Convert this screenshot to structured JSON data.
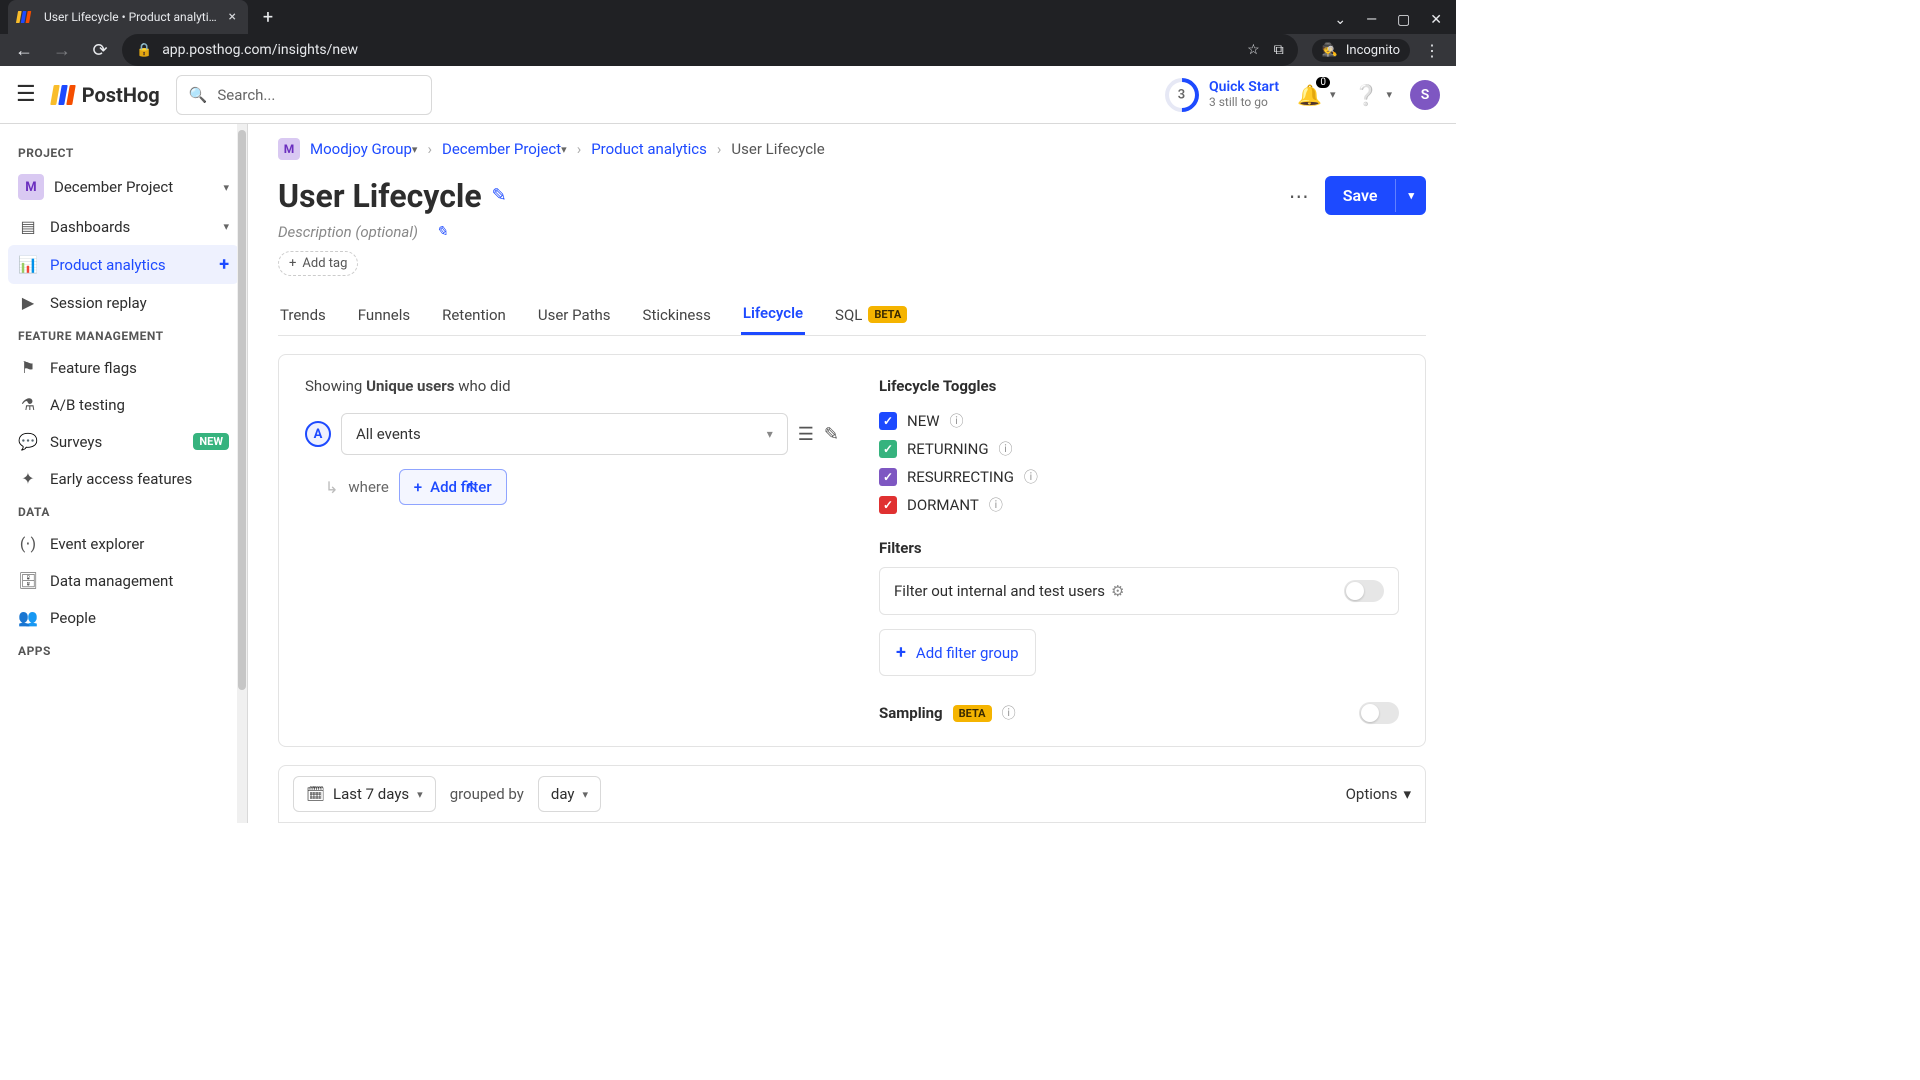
{
  "browser": {
    "tab_title": "User Lifecycle • Product analytics",
    "url": "app.posthog.com/insights/new",
    "incognito_label": "Incognito"
  },
  "header": {
    "brand": "PostHog",
    "search_placeholder": "Search...",
    "quick_start": {
      "count": "3",
      "title": "Quick Start",
      "subtitle": "3 still to go"
    },
    "notif_badge": "0",
    "avatar_initial": "S"
  },
  "sidebar": {
    "project_section": "PROJECT",
    "project_initial": "M",
    "project_name": "December Project",
    "items": {
      "dashboards": "Dashboards",
      "product_analytics": "Product analytics",
      "session_replay": "Session replay"
    },
    "feature_section": "FEATURE MANAGEMENT",
    "feature_items": {
      "feature_flags": "Feature flags",
      "ab_testing": "A/B testing",
      "surveys": "Surveys",
      "surveys_badge": "NEW",
      "early_access": "Early access features"
    },
    "data_section": "DATA",
    "data_items": {
      "event_explorer": "Event explorer",
      "data_management": "Data management",
      "people": "People"
    },
    "apps_section": "APPS"
  },
  "breadcrumb": {
    "org_initial": "M",
    "org": "Moodjoy Group",
    "project": "December Project",
    "area": "Product analytics",
    "page": "User Lifecycle"
  },
  "page": {
    "title": "User Lifecycle",
    "description_placeholder": "Description (optional)",
    "add_tag": "Add tag",
    "save": "Save"
  },
  "tabs": {
    "trends": "Trends",
    "funnels": "Funnels",
    "retention": "Retention",
    "user_paths": "User Paths",
    "stickiness": "Stickiness",
    "lifecycle": "Lifecycle",
    "sql": "SQL",
    "beta": "BETA"
  },
  "query": {
    "showing_prefix": "Showing",
    "showing_bold": "Unique users",
    "showing_suffix": "who did",
    "series_letter": "A",
    "event_value": "All events",
    "where": "where",
    "add_filter": "Add filter"
  },
  "toggles": {
    "title": "Lifecycle Toggles",
    "new": "NEW",
    "returning": "RETURNING",
    "resurrecting": "RESURRECTING",
    "dormant": "DORMANT"
  },
  "filters": {
    "title": "Filters",
    "internal": "Filter out internal and test users",
    "add_group": "Add filter group",
    "sampling": "Sampling",
    "beta": "BETA"
  },
  "footer": {
    "range": "Last 7 days",
    "grouped_by": "grouped by",
    "interval": "day",
    "options": "Options"
  }
}
